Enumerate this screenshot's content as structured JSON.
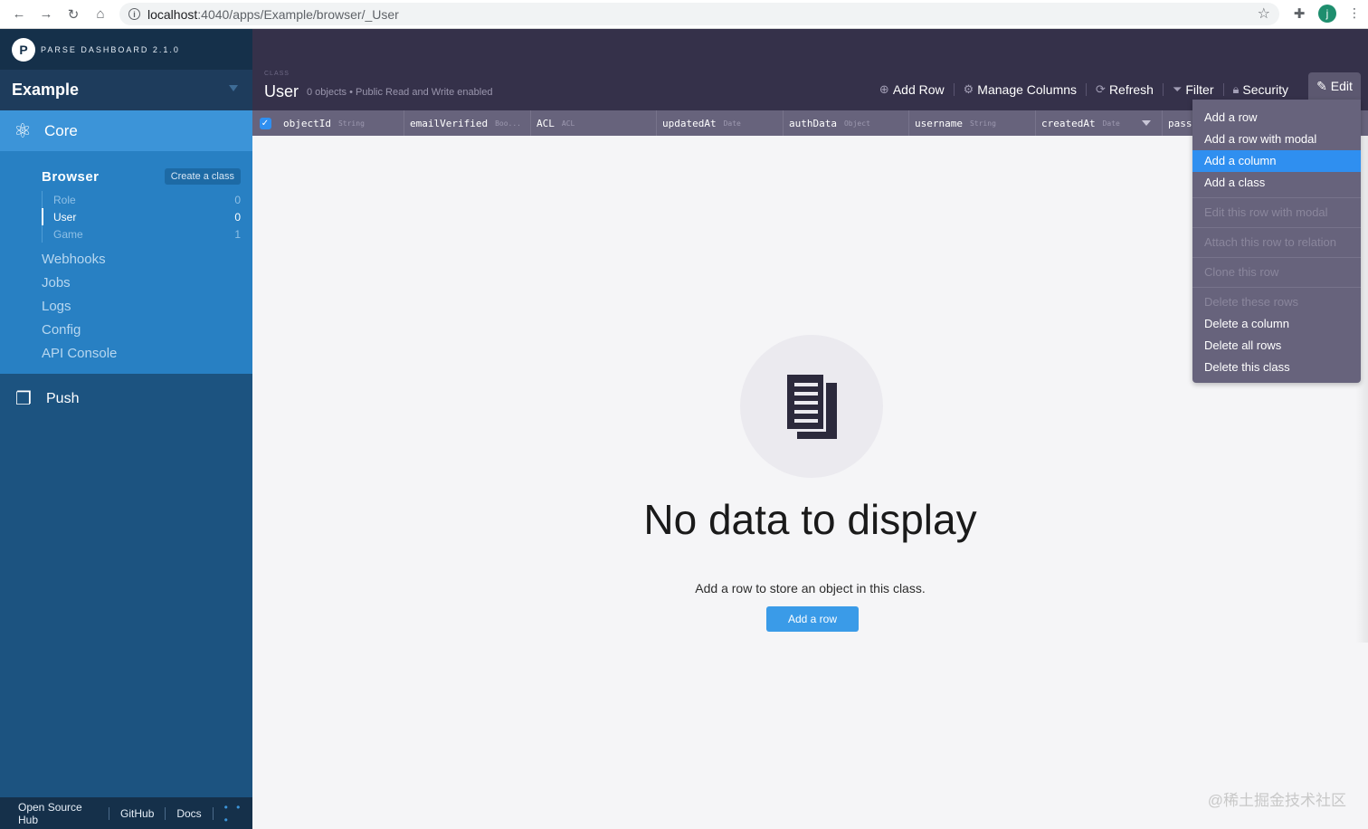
{
  "browser": {
    "url_host": "localhost",
    "url_path": ":4040/apps/Example/browser/_User",
    "profile_initial": "j"
  },
  "sidebar": {
    "brand_version": "PARSE DASHBOARD 2.1.0",
    "app_name": "Example",
    "core_label": "Core",
    "browser_label": "Browser",
    "create_class_label": "Create a class",
    "classes": [
      {
        "name": "Role",
        "count": "0"
      },
      {
        "name": "User",
        "count": "0"
      },
      {
        "name": "Game",
        "count": "1"
      }
    ],
    "nav": [
      "Webhooks",
      "Jobs",
      "Logs",
      "Config",
      "API Console"
    ],
    "push_label": "Push",
    "footer": [
      "Open Source Hub",
      "GitHub",
      "Docs"
    ],
    "footer_more": "• • •"
  },
  "toolbar": {
    "subtitle": "CLASS",
    "title": "User",
    "meta": "0 objects • Public Read and Write enabled",
    "actions": [
      "Add Row",
      "Manage Columns",
      "Refresh",
      "Filter",
      "Security"
    ],
    "edit_label": "Edit"
  },
  "columns": [
    {
      "name": "objectId",
      "type": "String"
    },
    {
      "name": "emailVerified",
      "type": "Boo..."
    },
    {
      "name": "ACL",
      "type": "ACL"
    },
    {
      "name": "updatedAt",
      "type": "Date"
    },
    {
      "name": "authData",
      "type": "Object"
    },
    {
      "name": "username",
      "type": "String"
    },
    {
      "name": "createdAt",
      "type": "Date"
    },
    {
      "name": "pass",
      "type": ""
    }
  ],
  "empty_state": {
    "title": "No data to display",
    "description": "Add a row to store an object in this class.",
    "button": "Add a row"
  },
  "edit_menu": {
    "groups": [
      [
        "Add a row",
        "Add a row with modal",
        "Add a column",
        "Add a class"
      ],
      [
        "Edit this row with modal"
      ],
      [
        "Attach this row to relation"
      ],
      [
        "Clone this row"
      ],
      [
        "Delete these rows",
        "Delete a column",
        "Delete all rows",
        "Delete this class"
      ]
    ],
    "highlighted": "Add a column",
    "disabled": [
      "Edit this row with modal",
      "Attach this row to relation",
      "Clone this row",
      "Delete these rows"
    ]
  },
  "watermark": "@稀土掘金技术社区"
}
